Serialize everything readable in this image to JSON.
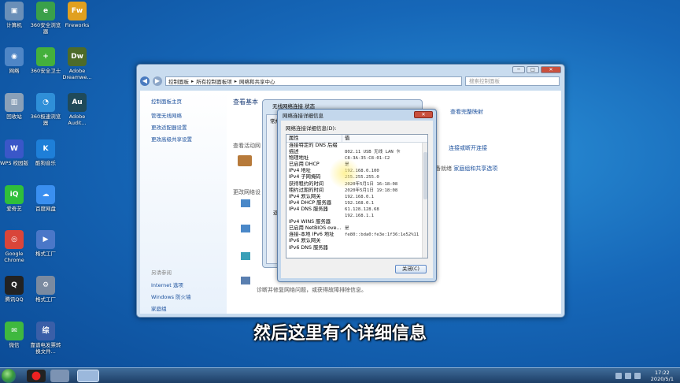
{
  "desktop": {
    "icons": [
      {
        "label": "计算机",
        "color": "#6a8fb8",
        "glyph": "▣"
      },
      {
        "label": "360安全浏览器",
        "color": "#3aa04a",
        "glyph": "e"
      },
      {
        "label": "Fireworks",
        "color": "#e0a020",
        "glyph": "Fw"
      },
      {
        "label": "网络",
        "color": "#4f86c6",
        "glyph": "◉"
      },
      {
        "label": "360安全卫士",
        "color": "#44b03c",
        "glyph": "+"
      },
      {
        "label": "Adobe Dreamwe...",
        "color": "#4d6b2a",
        "glyph": "Dw"
      },
      {
        "label": "回收站",
        "color": "#8aa0b8",
        "glyph": "▥"
      },
      {
        "label": "360极速浏览器",
        "color": "#2f8fd8",
        "glyph": "◔"
      },
      {
        "label": "Adobe Audit...",
        "color": "#1f4a5a",
        "glyph": "Au"
      },
      {
        "label": "WPS 校园版",
        "color": "#3a57c8",
        "glyph": "W"
      },
      {
        "label": "酷狗音乐",
        "color": "#1e7fd8",
        "glyph": "K"
      },
      {
        "label": "爱奇艺",
        "color": "#2fbf3a",
        "glyph": "iQ"
      },
      {
        "label": "百度网盘",
        "color": "#3a8ff0",
        "glyph": "☁"
      },
      {
        "label": "Google Chrome",
        "color": "#d9453a",
        "glyph": "◎"
      },
      {
        "label": "格式工厂",
        "color": "#4a77c8",
        "glyph": "▶"
      },
      {
        "label": "腾讯QQ",
        "color": "#222222",
        "glyph": "Q"
      },
      {
        "label": "格式工厂",
        "color": "#7a8aa0",
        "glyph": "⚙"
      },
      {
        "label": "微信",
        "color": "#3fb83f",
        "glyph": "✉"
      },
      {
        "label": "靠谱电发票转换文件...",
        "color": "#3a5fa8",
        "glyph": "综"
      }
    ]
  },
  "explorer": {
    "minimize": "─",
    "maximize": "□",
    "close": "✕",
    "back": "◀",
    "forward": "▶",
    "breadcrumb": [
      "控制面板",
      "所有控制面板项",
      "网络和共享中心"
    ],
    "search_placeholder": "搜索控制面板",
    "sidebar": {
      "home": "控制面板主页",
      "items": [
        "管理无线网络",
        "更改适配器设置",
        "更改高级共享设置"
      ],
      "see_also_title": "另请参阅",
      "see_also": [
        "Internet 选项",
        "Windows 防火墙",
        "家庭组"
      ]
    },
    "main": {
      "heading_prefix": "查看基本",
      "active_net": "查看活动网",
      "change_net": "更改网络设",
      "right_link1": "查看完整映射",
      "right_link2": "连接或断开连接",
      "right_link3": "家庭组和共享选项",
      "right_link3_prefix": "准备就绪",
      "bottom_text": "诊断并修复网络问题，或获得故障排除信息。",
      "back_dialog_title": "无线网络连接 状态",
      "back_dialog_tab": "常规",
      "back_dialog_side_label": "远"
    }
  },
  "details_dialog": {
    "title": "网络连接详细信息",
    "close": "✕",
    "label": "网络连接详细信息(D):",
    "col_property": "属性",
    "col_value": "值",
    "rows": [
      {
        "p": "连接特定的 DNS 后缀",
        "v": ""
      },
      {
        "p": "描述",
        "v": "802.11 USB 无线 LAN 卡"
      },
      {
        "p": "物理地址",
        "v": "C8-3A-35-C8-01-C2"
      },
      {
        "p": "已启用 DHCP",
        "v": "是"
      },
      {
        "p": "IPv4 地址",
        "v": "192.168.0.100"
      },
      {
        "p": "IPv4 子网掩码",
        "v": "255.255.255.0"
      },
      {
        "p": "获得租约的时间",
        "v": "2020年5月1日 16:18:08"
      },
      {
        "p": "租约过期的时间",
        "v": "2020年5月1日 19:18:08"
      },
      {
        "p": "IPv4 默认网关",
        "v": "192.168.0.1"
      },
      {
        "p": "IPv4 DHCP 服务器",
        "v": "192.168.0.1"
      },
      {
        "p": "IPv4 DNS 服务器",
        "v": "61.128.128.68"
      },
      {
        "p": "",
        "v": "192.168.1.1"
      },
      {
        "p": "IPv4 WINS 服务器",
        "v": ""
      },
      {
        "p": "已启用 NetBIOS ove...",
        "v": "是"
      },
      {
        "p": "连接-本地 IPv6 地址",
        "v": "fe80::bda0:fe3e:1f36:1e52%11"
      },
      {
        "p": "IPv6 默认网关",
        "v": ""
      },
      {
        "p": "IPv6 DNS 服务器",
        "v": ""
      }
    ],
    "close_button": "关闭(C)"
  },
  "subtitle": "然后这里有个详细信息",
  "taskbar": {
    "time": "17:22",
    "date": "2020/5/1"
  }
}
